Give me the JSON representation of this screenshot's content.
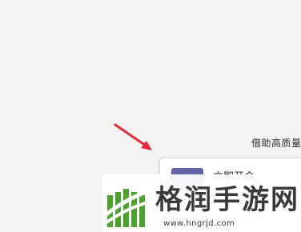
{
  "caption": {
    "text": "借助高质量"
  },
  "card": {
    "title": "立即开会"
  },
  "watermark": {
    "title": "格润手游网",
    "url": "www.hngrjd.com"
  },
  "colors": {
    "background": "#f4f3f1",
    "arrow": "#e02b3a",
    "card_icon": "#6264a7",
    "logo_green": "#4aa32b"
  },
  "icons": {
    "arrow": "red-arrow-annotation-icon",
    "card": "teams-meeting-icon",
    "logo": "grun-logo-icon"
  }
}
